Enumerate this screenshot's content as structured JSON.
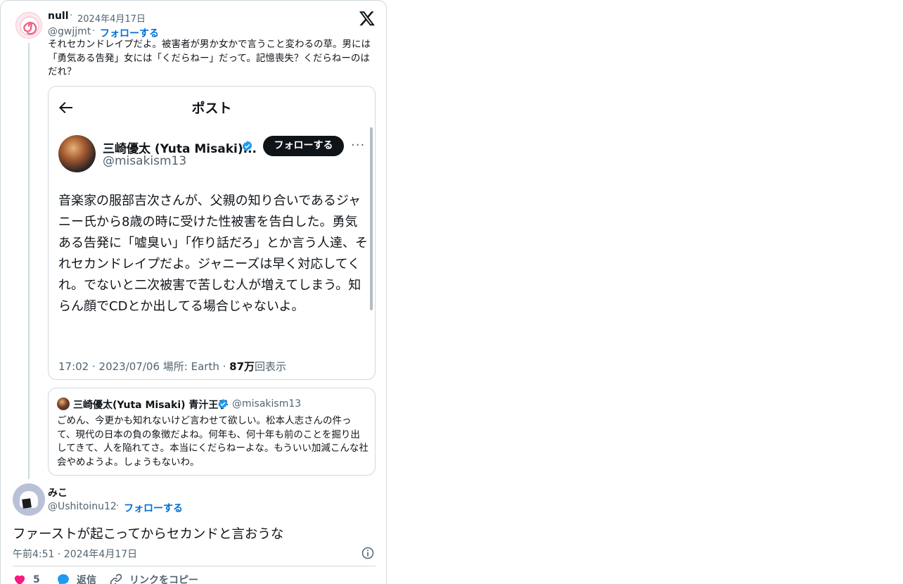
{
  "colors": {
    "link": "#006fd6",
    "muted": "#536471",
    "verified": "#1d9bf0",
    "heart": "#f91880"
  },
  "parent": {
    "name": "null",
    "date": "2024年4月17日",
    "handle": "@gwjjmt",
    "follow": "フォローする",
    "text": "それセカンドレイプだよ。被害者が男か女かで言うこと変わるの草。男には「勇気ある告発」女には「くだらねー」だって。記憶喪失？くだらねーのはだれ？"
  },
  "embed": {
    "header": "ポスト",
    "name": "三崎優太 (Yuta Misaki)...",
    "handle": "@misakism13",
    "follow": "フォローする",
    "more": "···",
    "body": "音楽家の服部吉次さんが、父親の知り合いであるジャニー氏から8歳の時に受けた性被害を告白した。勇気ある告発に「嘘臭い」「作り話だろ」とか言う人達、それセカンドレイプだよ。ジャニーズは早く対応してくれ。でないと二次被害で苦しむ人が増えてしまう。知らん顔でCDとか出してる場合じゃないよ。",
    "meta_time": "17:02 · 2023/07/06",
    "meta_location": "場所: Earth · ",
    "meta_views_count": "87万",
    "meta_views_label": "回表示"
  },
  "quote": {
    "name": "三崎優太(Yuta Misaki) 青汁王子",
    "handle": "@misakism13",
    "text": "ごめん、今更かも知れないけど言わせて欲しい。松本人志さんの件って、現代の日本の負の象徴だよね。何年も、何十年も前のことを掘り出してきて、人を陥れてさ。本当にくだらねーよな。もういい加減こんな社会やめようよ。しょうもないわ。"
  },
  "reply": {
    "name": "みこ",
    "handle": "@Ushitoinu12",
    "follow": "フォローする",
    "text": "ファーストが起こってからセカンドと言おうな",
    "time": "午前4:51 · 2024年4月17日"
  },
  "actions": {
    "likes": "5",
    "reply": "返信",
    "copy_link": "リンクをコピー"
  },
  "icons": [
    "x-logo-icon",
    "back-arrow-icon",
    "verified-badge-icon",
    "info-icon",
    "heart-icon",
    "reply-bubble-icon",
    "link-icon"
  ]
}
